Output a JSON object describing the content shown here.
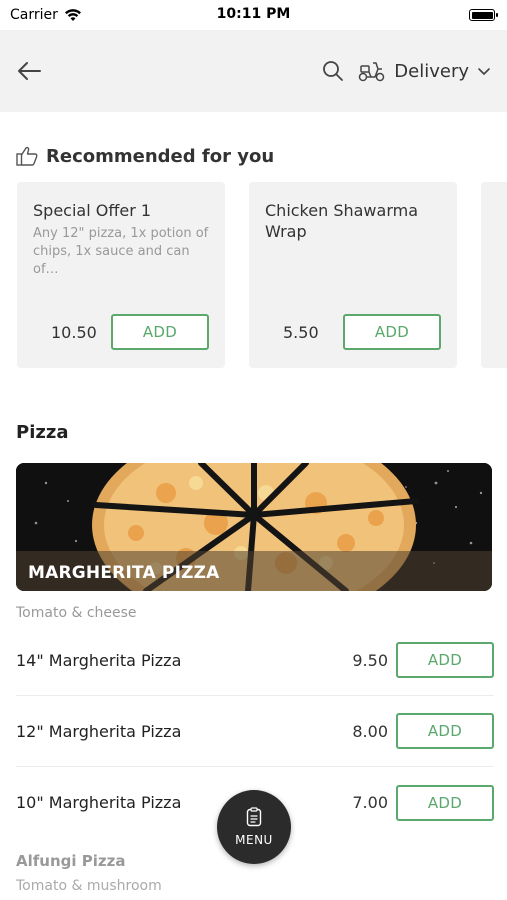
{
  "status_bar": {
    "carrier": "Carrier",
    "time": "10:11 PM"
  },
  "header": {
    "back_icon": "arrow-left-icon",
    "search_icon": "search-icon",
    "delivery_icon": "scooter-icon",
    "delivery_label": "Delivery",
    "chevron_icon": "chevron-down-icon"
  },
  "recommended": {
    "title": "Recommended for you",
    "icon": "thumbs-up-icon",
    "items": [
      {
        "title": "Special Offer 1",
        "description": "Any 12\" pizza, 1x potion of chips, 1x sauce and can of…",
        "price": "10.50",
        "add_label": "ADD"
      },
      {
        "title": "Chicken Shawarma Wrap",
        "description": "",
        "price": "5.50",
        "add_label": "ADD"
      }
    ]
  },
  "category": {
    "title": "Pizza",
    "banner_title": "MARGHERITA PIZZA",
    "banner_subtitle": "Tomato & cheese",
    "items": [
      {
        "name": "14\" Margherita Pizza",
        "price": "9.50",
        "add_label": "ADD"
      },
      {
        "name": "12\" Margherita Pizza",
        "price": "8.00",
        "add_label": "ADD"
      },
      {
        "name": "10\" Margherita Pizza",
        "price": "7.00",
        "add_label": "ADD"
      }
    ]
  },
  "next_section": {
    "title": "Alfungi Pizza",
    "subtitle": "Tomato & mushroom"
  },
  "menu_button": {
    "label": "MENU",
    "icon": "menu-clipboard-icon"
  },
  "colors": {
    "accent": "#5aa86b",
    "header_bg": "#f2f2f2",
    "fab_bg": "#2b2b2b"
  }
}
